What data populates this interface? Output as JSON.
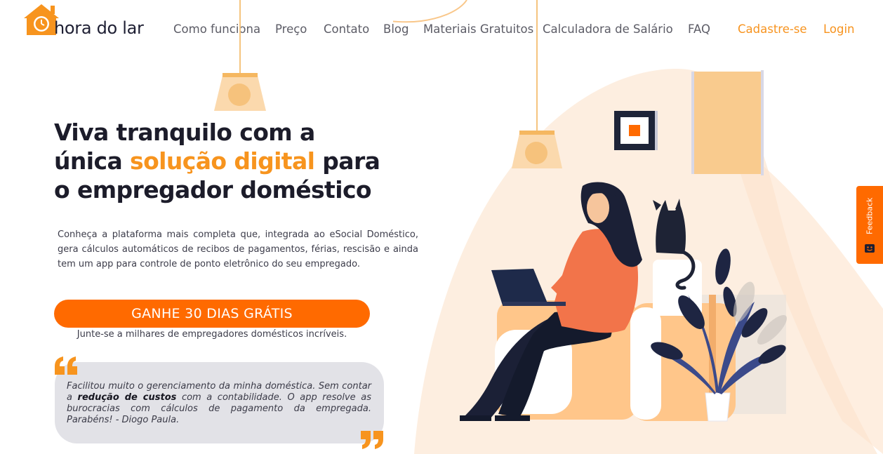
{
  "brand": {
    "name": "hora do lar",
    "logo_icon": "house-clock-icon",
    "accent_color": "#f7931e",
    "cta_color": "#ff6a00"
  },
  "nav": {
    "items": [
      "Como funciona",
      "Preço",
      "Contato",
      "Blog",
      "Materiais Gratuitos",
      "Calculadora de Salário",
      "FAQ"
    ],
    "signup": "Cadastre-se",
    "login": "Login"
  },
  "hero": {
    "title_line1": "Viva tranquilo com a",
    "title_line2_pre": "única ",
    "title_line2_accent": "solução digital",
    "title_line2_post": " para",
    "title_line3": "o empregador doméstico",
    "description": "Conheça a plataforma mais completa que, integrada ao eSocial Doméstico, gera cálculos automáticos de recibos de pagamentos, férias, rescisão e ainda tem um app para controle de ponto eletrônico do seu empregado.",
    "cta_label": "GANHE 30 DIAS GRÁTIS",
    "cta_subtext": "Junte-se a milhares de empregadores domésticos incríveis."
  },
  "testimonial": {
    "text_before": "Facilitou muito o gerenciamento da minha doméstica. Sem contar a ",
    "highlight": "redução de custos",
    "text_after": " com a contabilidade. O app resolve as burocracias com cálculos de pagamento da empregada. Parabéns! - Diogo Paula.",
    "open_icon": "quote-open-icon",
    "close_icon": "quote-close-icon"
  },
  "feedback": {
    "label": "Feedback",
    "icon": "feedback-face-icon"
  }
}
